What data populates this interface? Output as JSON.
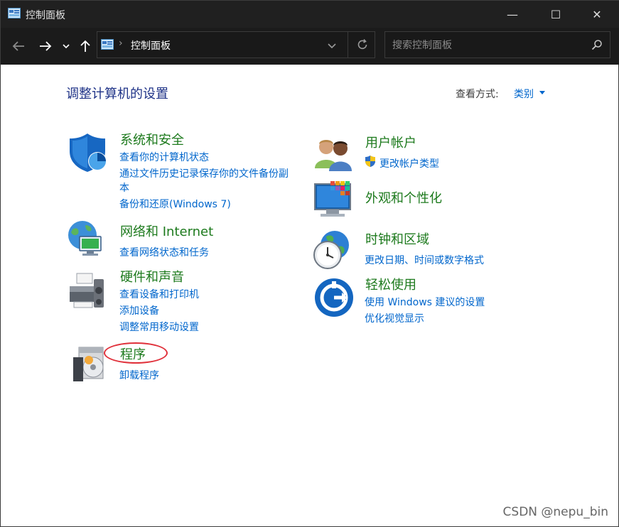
{
  "window": {
    "title": "控制面板",
    "controls": {
      "minimize": "—",
      "maximize": "☐",
      "close": "✕"
    }
  },
  "nav": {
    "back_icon": "arrow-left-icon",
    "forward_icon": "arrow-right-icon",
    "recent_icon": "chevron-down-icon",
    "up_icon": "arrow-up-icon"
  },
  "address": {
    "crumb": "控制面板",
    "separator": "›"
  },
  "search": {
    "placeholder": "搜索控制面板"
  },
  "main": {
    "heading": "调整计算机的设置",
    "view_by_label": "查看方式:",
    "view_by_value": "类别"
  },
  "categories": [
    {
      "title": "系统和安全",
      "links": [
        "查看你的计算机状态",
        "通过文件历史记录保存你的文件备份副",
        "本",
        "备份和还原(Windows 7)"
      ]
    },
    {
      "title": "网络和 Internet",
      "links": [
        "查看网络状态和任务"
      ]
    },
    {
      "title": "硬件和声音",
      "links": [
        "查看设备和打印机",
        "添加设备",
        "调整常用移动设置"
      ]
    },
    {
      "title": "程序",
      "links": [
        "卸载程序"
      ]
    },
    {
      "title": "用户帐户",
      "links": [
        "更改帐户类型"
      ]
    },
    {
      "title": "外观和个性化",
      "links": []
    },
    {
      "title": "时钟和区域",
      "links": [
        "更改日期、时间或数字格式"
      ]
    },
    {
      "title": "轻松使用",
      "links": [
        "使用 Windows 建议的设置",
        "优化视觉显示"
      ]
    }
  ],
  "watermark": "CSDN @nepu_bin",
  "colors": {
    "titlebar": "#202020",
    "navbar": "#1b1b1b",
    "link": "#0066cc",
    "category_title": "#1d7a1d",
    "heading": "#1e3287",
    "annotation": "#e0303a"
  }
}
